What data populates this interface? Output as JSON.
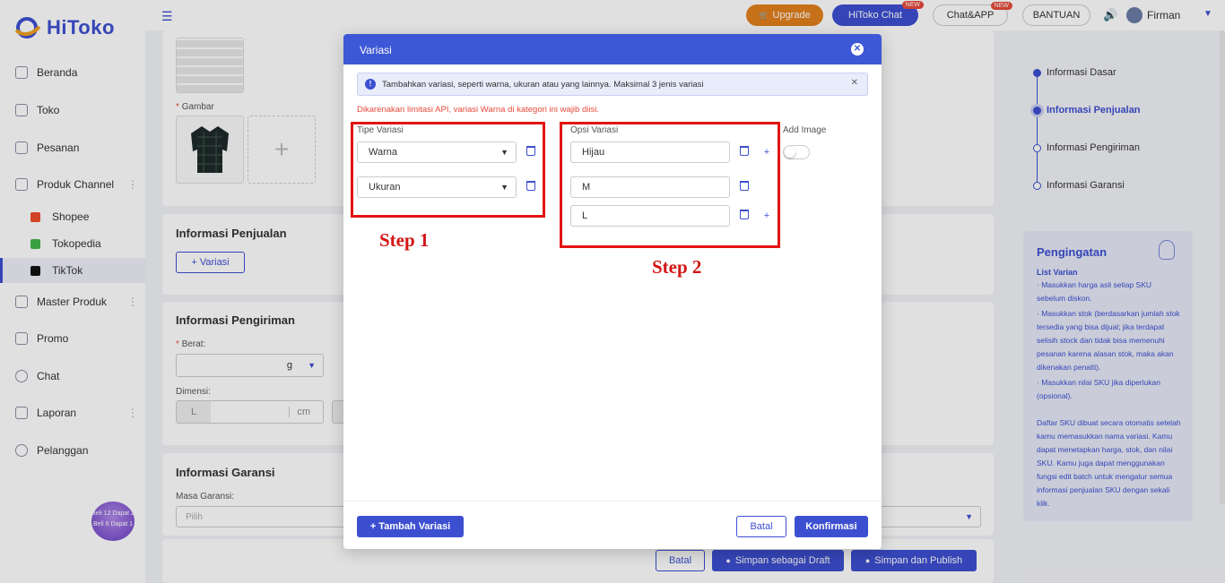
{
  "app": {
    "brand": "HiToko"
  },
  "sidebar": {
    "items": [
      {
        "label": "Beranda"
      },
      {
        "label": "Toko"
      },
      {
        "label": "Pesanan"
      },
      {
        "label": "Produk Channel"
      },
      {
        "label": "Master Produk"
      },
      {
        "label": "Promo"
      },
      {
        "label": "Chat"
      },
      {
        "label": "Laporan"
      },
      {
        "label": "Pelanggan"
      }
    ],
    "subitems": [
      {
        "label": "Shopee",
        "color": "#ee4d2d"
      },
      {
        "label": "Tokopedia",
        "color": "#42b549"
      },
      {
        "label": "TikTok",
        "color": "#111111"
      }
    ],
    "promo_badge": "Beli 12 Dapat 2 Beli 6 Dapat 1"
  },
  "topbar": {
    "upgrade_label": "Upgrade",
    "hitoko_chat_label": "HiToko Chat",
    "chat_app_label": "Chat&APP",
    "new_tag": "NEW",
    "bantuan_label": "BANTUAN",
    "user_name": "Firman"
  },
  "page": {
    "gambar_label": "Gambar",
    "penjualan_title": "Informasi Penjualan",
    "variasi_button": "+ Variasi",
    "pengiriman_title": "Informasi Pengiriman",
    "berat_label": "Berat:",
    "berat_unit": "g",
    "dimensi_label": "Dimensi:",
    "dimensi_l": "L",
    "dimensi_unit": "cm",
    "garansi_title": "Informasi Garansi",
    "masa_garansi_label": "Masa Garansi:",
    "masa_garansi_placeholder": "Pilih",
    "batal_label": "Batal",
    "draft_label": "Simpan sebagai Draft",
    "publish_label": "Simpan dan Publish"
  },
  "steps": [
    {
      "label": "Informasi Dasar"
    },
    {
      "label": "Informasi Penjualan"
    },
    {
      "label": "Informasi Pengiriman"
    },
    {
      "label": "Informasi Garansi"
    }
  ],
  "reminder": {
    "title": "Pengingatan",
    "subtitle": "List Varian",
    "text1": "· Masukkan harga asli setiap SKU sebelum diskon.",
    "text2": "· Masukkan stok (berdasarkan jumlah stok tersedia yang bisa dijual; jika terdapat selisih stock dan tidak bisa memenuhi pesanan karena alasan stok, maka akan dikenakan penalti).",
    "text3": "· Masukkan nilai SKU jika diperlukan (opsional).",
    "text4": "Daftar SKU dibuat secara otomatis setelah kamu memasukkan nama variasi. Kamu dapat menetapkan harga, stok, dan nilai SKU. Kamu juga dapat menggunakan fungsi edit batch untuk mengatur semua informasi penjualan SKU dengan sekali klik."
  },
  "modal": {
    "title": "Variasi",
    "info": "Tambahkan variasi, seperti warna, ukuran atau yang lainnya. Maksimal 3 jenis variasi",
    "warning": "Dikarenakan limitasi API, variasi Warna di kategori ini wajib diisi.",
    "tipe_label": "Tipe Variasi",
    "opsi_label": "Opsi Variasi",
    "add_image_label": "Add Image",
    "tipe": [
      "Warna",
      "Ukuran"
    ],
    "opsi": [
      "Hijau",
      "M",
      "L"
    ],
    "add_variasi_label": "+ Tambah Variasi",
    "batal_label": "Batal",
    "konfirmasi_label": "Konfirmasi"
  },
  "annotations": {
    "step1": "Step 1",
    "step2": "Step 2"
  }
}
